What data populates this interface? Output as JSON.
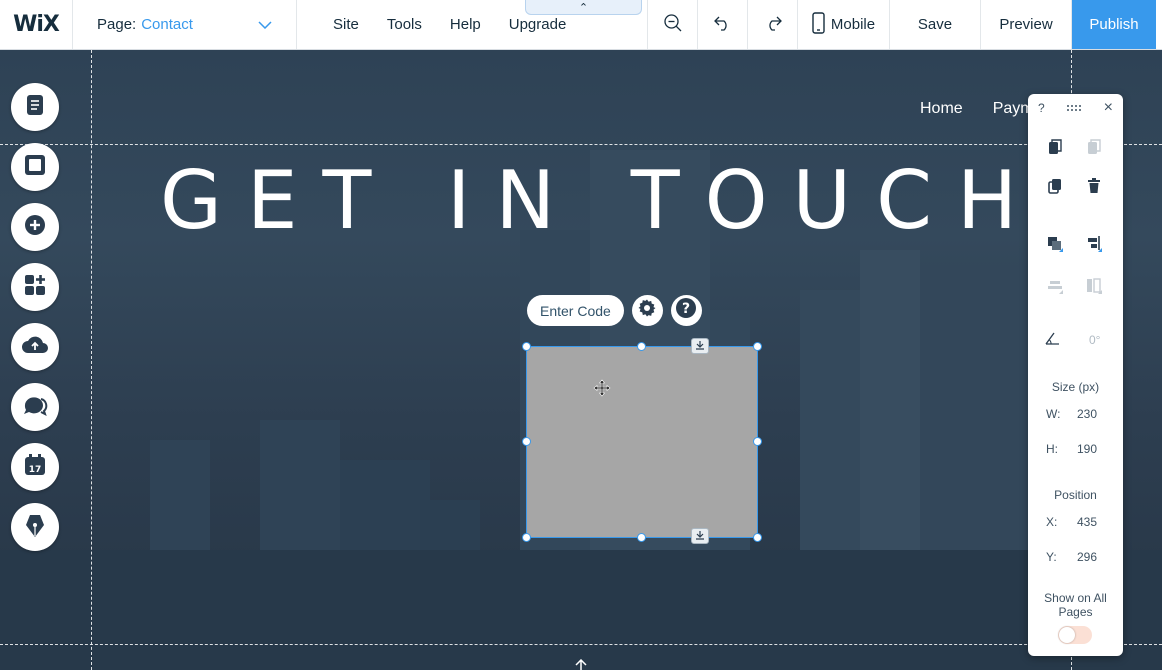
{
  "topbar": {
    "logo": "WiX",
    "page_label": "Page:",
    "page_value": "Contact",
    "menu": [
      "Site",
      "Tools",
      "Help",
      "Upgrade"
    ],
    "mobile_label": "Mobile",
    "save_label": "Save",
    "preview_label": "Preview",
    "publish_label": "Publish",
    "upgrade_tab_glyph": "⌃"
  },
  "site": {
    "nav": [
      "Home",
      "Payme..."
    ],
    "headline": "GET IN TOUCH"
  },
  "left_tools": [
    "pages-icon",
    "background-icon",
    "add-icon",
    "app-market-icon",
    "upload-icon",
    "chat-icon",
    "bookings-icon",
    "blog-pen-icon"
  ],
  "code_element": {
    "enter_code_label": "Enter Code"
  },
  "panel": {
    "help": "?",
    "close": "×",
    "rotation": "0°",
    "size_label": "Size (px)",
    "w_label": "W:",
    "w_value": "230",
    "h_label": "H:",
    "h_value": "190",
    "position_label": "Position",
    "x_label": "X:",
    "x_value": "435",
    "y_label": "Y:",
    "y_value": "296",
    "show_all_pages_label": "Show on All Pages",
    "show_all_pages": false
  },
  "colors": {
    "accent": "#3899ec",
    "canvas_bg": "#2e4255",
    "embed_placeholder": "#a6a6a6"
  }
}
